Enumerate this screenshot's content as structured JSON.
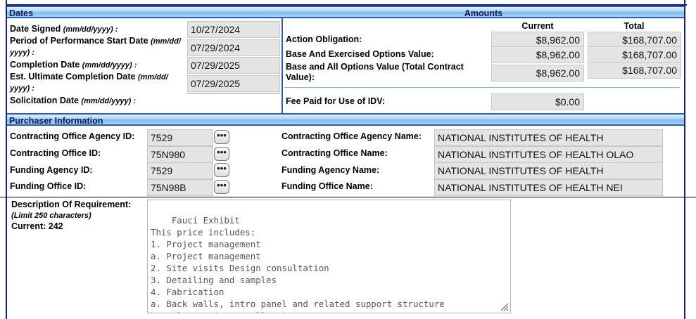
{
  "sections": {
    "dates": "Dates",
    "amounts": "Amounts",
    "purchaser": "Purchaser Information"
  },
  "dates": {
    "date_signed": {
      "label": "Date Signed",
      "hint": "(mm/dd/yyyy) :",
      "value": "10/27/2024"
    },
    "pop_start": {
      "label": "Period of Performance Start Date",
      "hint1": "(mm/dd/",
      "hint2": "yyyy) :",
      "value": "07/29/2024"
    },
    "completion": {
      "label": "Completion Date",
      "hint": "(mm/dd/yyyy) :",
      "value": "07/29/2025"
    },
    "est_ultimate": {
      "label": "Est. Ultimate Completion Date",
      "hint1": "(mm/dd/",
      "hint2": "yyyy) :",
      "value": "07/29/2025"
    },
    "solicitation": {
      "label": "Solicitation Date",
      "hint": "(mm/dd/yyyy) :",
      "value": ""
    }
  },
  "amounts": {
    "col_current": "Current",
    "col_total": "Total",
    "action_obligation": {
      "label": "Action Obligation:",
      "current": "$8,962.00",
      "total": "$168,707.00"
    },
    "base_exercised": {
      "label": "Base And Exercised Options Value:",
      "current": "$8,962.00",
      "total": "$168,707.00"
    },
    "base_all": {
      "label1": "Base and All Options Value (Total Contract",
      "label2": "Value):",
      "current": "$8,962.00",
      "total": "$168,707.00"
    },
    "fee_idv": {
      "label": "Fee Paid for Use of IDV:",
      "current": "$0.00"
    }
  },
  "purchaser": {
    "co_agency_id": {
      "label": "Contracting Office Agency ID:",
      "value": "7529"
    },
    "co_id": {
      "label": "Contracting Office ID:",
      "value": "75N980"
    },
    "funding_agency_id": {
      "label": "Funding Agency ID:",
      "value": "7529"
    },
    "funding_office_id": {
      "label": "Funding Office ID:",
      "value": "75N98B"
    },
    "co_agency_name": {
      "label": "Contracting Office Agency Name:",
      "value": "NATIONAL INSTITUTES OF HEALTH"
    },
    "co_name": {
      "label": "Contracting Office Name:",
      "value": "NATIONAL INSTITUTES OF HEALTH OLAO"
    },
    "funding_agency_name": {
      "label": "Funding Agency Name:",
      "value": "NATIONAL INSTITUTES OF HEALTH"
    },
    "funding_office_name": {
      "label": "Funding Office Name:",
      "value": "NATIONAL INSTITUTES OF HEALTH NEI"
    },
    "lookup_glyph": "•••"
  },
  "description": {
    "label": "Description Of Requirement:",
    "limit": "(Limit 250 characters)",
    "current": "Current: 242",
    "text": "Fauci Exhibit\nThis price includes:\n1. Project management\na. Project management\n2. Site visits Design consultation\n3. Detailing and samples\n4. Fabrication\na. Back walls, intro panel and related support structure\nb. Columns, inner walls with Le"
  }
}
